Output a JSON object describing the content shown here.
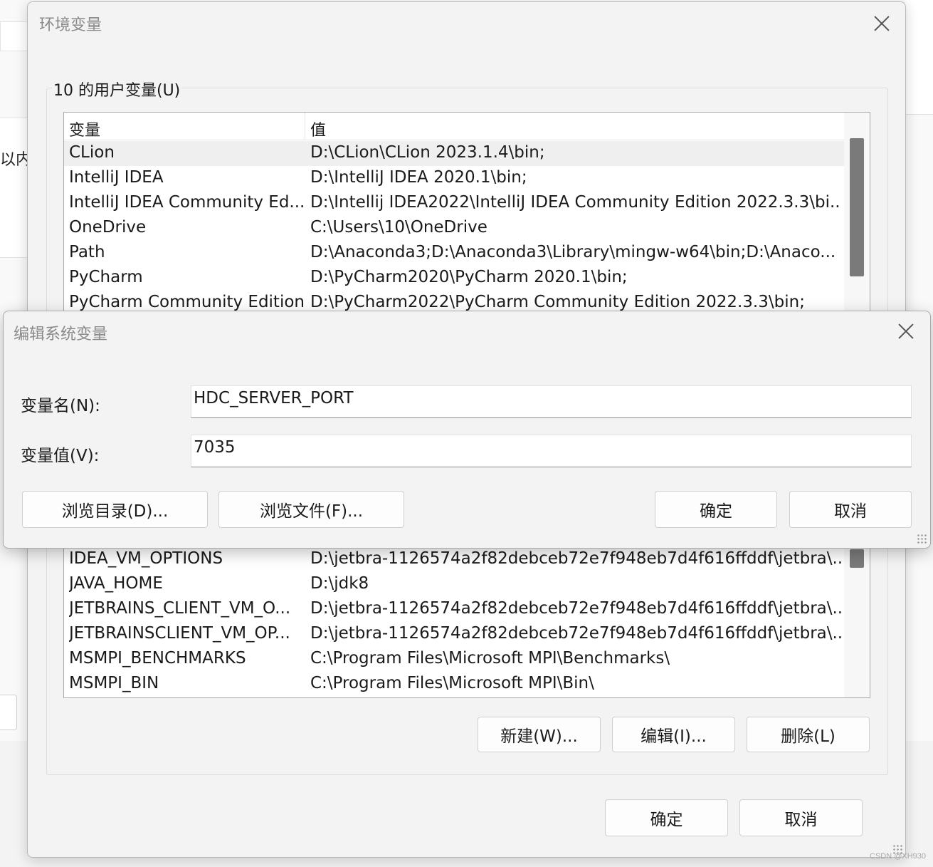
{
  "background": {
    "partial_label": "以内"
  },
  "env_dialog": {
    "title": "环境变量",
    "user_group_label": "10 的用户变量(U)",
    "columns": [
      "变量",
      "值"
    ],
    "rows_top": [
      {
        "name": "CLion",
        "value": "D:\\CLion\\CLion 2023.1.4\\bin;"
      },
      {
        "name": "IntelliJ IDEA",
        "value": "D:\\IntelliJ IDEA 2020.1\\bin;"
      },
      {
        "name": "IntelliJ IDEA Community Ed...",
        "value": "D:\\Intellij IDEA2022\\IntelliJ IDEA Community Edition 2022.3.3\\bi..."
      },
      {
        "name": "OneDrive",
        "value": "C:\\Users\\10\\OneDrive"
      },
      {
        "name": "Path",
        "value": "D:\\Anaconda3;D:\\Anaconda3\\Library\\mingw-w64\\bin;D:\\Anaco..."
      },
      {
        "name": "PyCharm",
        "value": "D:\\PyCharm2020\\PyCharm 2020.1\\bin;"
      },
      {
        "name": "PyCharm Community Edition",
        "value": "D:\\PyCharm2022\\PyCharm Community Edition 2022.3.3\\bin;"
      }
    ],
    "rows_bottom": [
      {
        "name": "IDEA_VM_OPTIONS",
        "value": "D:\\jetbra-1126574a2f82debceb72e7f948eb7d4f616ffddf\\jetbra\\..."
      },
      {
        "name": "JAVA_HOME",
        "value": "D:\\jdk8"
      },
      {
        "name": "JETBRAINS_CLIENT_VM_O...",
        "value": "D:\\jetbra-1126574a2f82debceb72e7f948eb7d4f616ffddf\\jetbra\\..."
      },
      {
        "name": "JETBRAINSCLIENT_VM_OP...",
        "value": "D:\\jetbra-1126574a2f82debceb72e7f948eb7d4f616ffddf\\jetbra\\..."
      },
      {
        "name": "MSMPI_BENCHMARKS",
        "value": "C:\\Program Files\\Microsoft MPI\\Benchmarks\\"
      },
      {
        "name": "MSMPI_BIN",
        "value": "C:\\Program Files\\Microsoft MPI\\Bin\\"
      }
    ],
    "new_button": "新建(W)...",
    "edit_button": "编辑(I)...",
    "delete_button": "删除(L)",
    "ok_button": "确定",
    "cancel_button": "取消"
  },
  "edit_dialog": {
    "title": "编辑系统变量",
    "name_label": "变量名(N):",
    "name_value": "HDC_SERVER_PORT",
    "value_label": "变量值(V):",
    "value_value": "7035",
    "browse_dir_button": "浏览目录(D)...",
    "browse_file_button": "浏览文件(F)...",
    "ok_button": "确定",
    "cancel_button": "取消"
  },
  "watermark": "CSDN @XH930"
}
